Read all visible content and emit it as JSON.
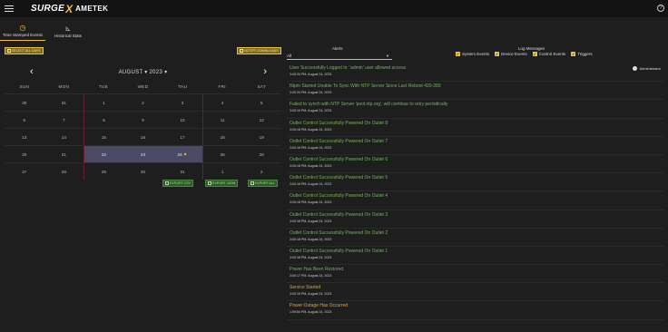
{
  "brand": {
    "name": "SURGE",
    "x": "X",
    "partner": "AMETEK"
  },
  "nav": {
    "tabs": [
      {
        "label": "Time Stamped Events"
      },
      {
        "label": "Historical Stats"
      }
    ]
  },
  "toolbar": {
    "select_all_days": "SELECT ALL DAYS",
    "notify_label": "NOTIFY DOWNLOADS"
  },
  "calendar": {
    "month_year": "AUGUST ▾ 2023 ▾",
    "prev": "‹",
    "next": "›",
    "weekdays": [
      "SUN",
      "MON",
      "TUE",
      "WED",
      "THU",
      "FRI",
      "SAT"
    ],
    "weeks": [
      [
        "30",
        "31",
        "1",
        "2",
        "3",
        "4",
        "5"
      ],
      [
        "6",
        "7",
        "8",
        "9",
        "10",
        "11",
        "12"
      ],
      [
        "13",
        "14",
        "15",
        "16",
        "17",
        "18",
        "19"
      ],
      [
        "20",
        "21",
        "22",
        "23",
        "24",
        "25",
        "26"
      ],
      [
        "27",
        "28",
        "29",
        "30",
        "31",
        "1",
        "2"
      ]
    ],
    "selected_days": [
      "22",
      "23",
      "24"
    ],
    "warning_day": "24"
  },
  "actions": {
    "export_csv": "EXPORT CSV",
    "export_json": "EXPORT JSON",
    "export_all": "EXPORT ALL"
  },
  "filters": {
    "alerts_label": "Alerts",
    "alerts_value": "All",
    "log_messages_label": "Log Messages",
    "log_types": [
      "System Events",
      "Device Events",
      "Control Events",
      "Triggers"
    ]
  },
  "events": [
    {
      "message": "User Successfully Logged In: 'admin' user allowed access",
      "time": "3:00:33 PM, August 24, 2023",
      "user": "Administrator",
      "color": "green"
    },
    {
      "message": "Ntpm Started Unable To Sync With NTP Server Since Last Reboot 420-280",
      "time": "3:00:33 PM, August 24, 2023",
      "color": "green"
    },
    {
      "message": "Failed to synch with NTP Server 'pool.ntp.org', will continue to retry periodically",
      "time": "3:00:19 PM, August 24, 2023",
      "color": "green"
    },
    {
      "message": "Outlet Control Successfully Powered On Outlet 8",
      "time": "3:00:18 PM, August 24, 2023",
      "color": "green"
    },
    {
      "message": "Outlet Control Successfully Powered On Outlet 7",
      "time": "3:00:18 PM, August 24, 2023",
      "color": "green"
    },
    {
      "message": "Outlet Control Successfully Powered On Outlet 6",
      "time": "3:00:18 PM, August 24, 2023",
      "color": "green"
    },
    {
      "message": "Outlet Control Successfully Powered On Outlet 5",
      "time": "3:00:18 PM, August 24, 2023",
      "color": "green"
    },
    {
      "message": "Outlet Control Successfully Powered On Outlet 4",
      "time": "3:00:18 PM, August 24, 2023",
      "color": "green"
    },
    {
      "message": "Outlet Control Successfully Powered On Outlet 3",
      "time": "3:00:18 PM, August 24, 2023",
      "color": "green"
    },
    {
      "message": "Outlet Control Successfully Powered On Outlet 2",
      "time": "3:00:18 PM, August 24, 2023",
      "color": "green"
    },
    {
      "message": "Outlet Control Successfully Powered On Outlet 1",
      "time": "3:00:18 PM, August 24, 2023",
      "color": "green"
    },
    {
      "message": "Power Has Been Restored",
      "time": "3:00:17 PM, August 24, 2023",
      "color": "green"
    },
    {
      "message": "Service Started",
      "time": "3:00:15 PM, August 24, 2023",
      "color": "orange"
    },
    {
      "message": "Power Outage Has Occurred",
      "time": "1:59:54 PM, August 24, 2023",
      "color": "orange"
    }
  ],
  "colors": {
    "accent": "#f2c230",
    "ok": "#71b85c",
    "warn": "#e7a33a",
    "bg": "#1e1e1e"
  }
}
